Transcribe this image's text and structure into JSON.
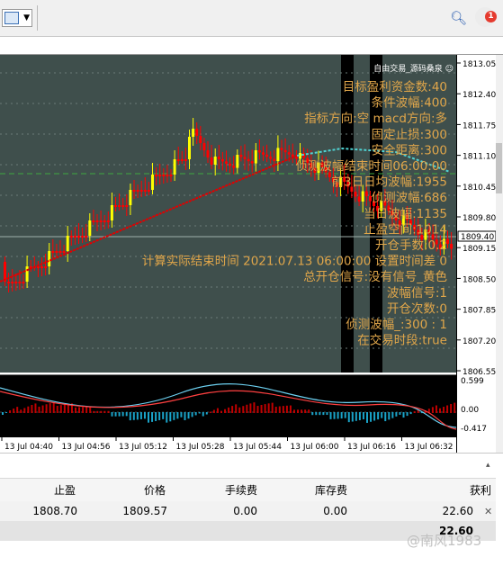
{
  "toolbar": {
    "notification_count": "1"
  },
  "chart": {
    "corner_label": "自由交易_源码桑泉 ☺",
    "current_price": "1809.40",
    "price_ticks": [
      "1813.05",
      "1812.40",
      "1811.75",
      "1811.10",
      "1810.45",
      "1809.80",
      "1809.15",
      "1808.50",
      "1807.85",
      "1807.20",
      "1806.55"
    ],
    "indicator_ticks": [
      "0.599",
      "0.00",
      "-0.417"
    ],
    "time_ticks": [
      "13 Jul 04:40",
      "13 Jul 04:56",
      "13 Jul 05:12",
      "13 Jul 05:28",
      "13 Jul 05:44",
      "13 Jul 06:00",
      "13 Jul 06:16",
      "13 Jul 06:32"
    ],
    "info": [
      "目标盈利资金数:40",
      "条件波幅:400",
      "指标方向:空  macd方向:多",
      "固定止损:300",
      "安全距离:300",
      "侦测波幅结束时间06:00:00",
      "前3日日均波幅:1955",
      "侦测波幅:686",
      "当日波幅:1135",
      "止盈空间:1014",
      "开仓手数:0.2",
      "计算实际结束时间 2021.07.13 06:00:00  设置时间差 0",
      "总开仓信号:没有信号_黄色",
      "波幅信号:1",
      "开仓次数:0",
      "侦测波幅_:300 : 1",
      "在交易时段:true"
    ]
  },
  "terminal": {
    "columns": [
      "止盈",
      "价格",
      "手续费",
      "库存费",
      "获利"
    ],
    "row": {
      "tp": "1808.70",
      "price": "1809.57",
      "commission": "0.00",
      "swap": "0.00",
      "profit": "22.60"
    },
    "total_profit": "22.60",
    "watermark": "@南风1983"
  },
  "colors": {
    "chart_bg": "#3f4f4c",
    "bull": "#ffff00",
    "bear": "#ff0000",
    "info_text": "#e0a64a",
    "ma_line": "#e00000"
  }
}
